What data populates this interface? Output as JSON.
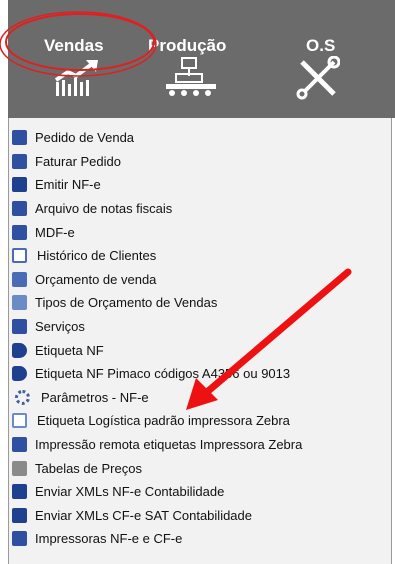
{
  "topbar": {
    "tabs": [
      {
        "label": "Vendas"
      },
      {
        "label": "Produção"
      },
      {
        "label": "O.S"
      }
    ]
  },
  "menu": {
    "items": [
      {
        "label": "Pedido de Venda",
        "icon": "document-list-icon",
        "color": "#2f4fa0"
      },
      {
        "label": "Faturar Pedido",
        "icon": "invoice-icon",
        "color": "#2f4fa0"
      },
      {
        "label": "Emitir NF-e",
        "icon": "nfe-document-icon",
        "color": "#1f3f8f"
      },
      {
        "label": "Arquivo de notas fiscais",
        "icon": "export-arrow-icon",
        "color": "#2f4fa0"
      },
      {
        "label": "MDF-e",
        "icon": "truck-icon",
        "color": "#2f4fa0"
      },
      {
        "label": "Histórico de Clientes",
        "icon": "calendar-icon",
        "color": "#4a6bb5"
      },
      {
        "label": "Orçamento de venda",
        "icon": "quote-icon",
        "color": "#4a6bb5"
      },
      {
        "label": "Tipos de Orçamento de Vendas",
        "icon": "hierarchy-icon",
        "color": "#6a8bc5"
      },
      {
        "label": "Serviços",
        "icon": "people-icon",
        "color": "#2f4fa0"
      },
      {
        "label": "Etiqueta NF",
        "icon": "tag-icon",
        "color": "#1f3f8f"
      },
      {
        "label": "Etiqueta NF Pimaco códigos A4356 ou 9013",
        "icon": "tag-icon",
        "color": "#1f3f8f"
      },
      {
        "label": "Parâmetros - NF-e",
        "icon": "gear-icon",
        "color": "#3f5f9f"
      },
      {
        "label": "Etiqueta Logística padrão impressora Zebra",
        "icon": "label-icon",
        "color": "#6a8bc5"
      },
      {
        "label": "Impressão remota etiquetas Impressora Zebra",
        "icon": "printer-icon",
        "color": "#2f4fa0"
      },
      {
        "label": "Tabelas de Preços",
        "icon": "price-table-icon",
        "color": "#8a8a8a"
      },
      {
        "label": "Enviar XMLs NF-e Contabilidade",
        "icon": "xml-send-icon",
        "color": "#1f3f8f"
      },
      {
        "label": "Enviar XMLs CF-e SAT Contabilidade",
        "icon": "xml-send-icon",
        "color": "#1f3f8f"
      },
      {
        "label": "Impressoras NF-e e CF-e",
        "icon": "printer-icon",
        "color": "#2f4fa0"
      }
    ]
  },
  "annotation": {
    "circle_color": "#e02020",
    "arrow_color": "#ee1111"
  }
}
